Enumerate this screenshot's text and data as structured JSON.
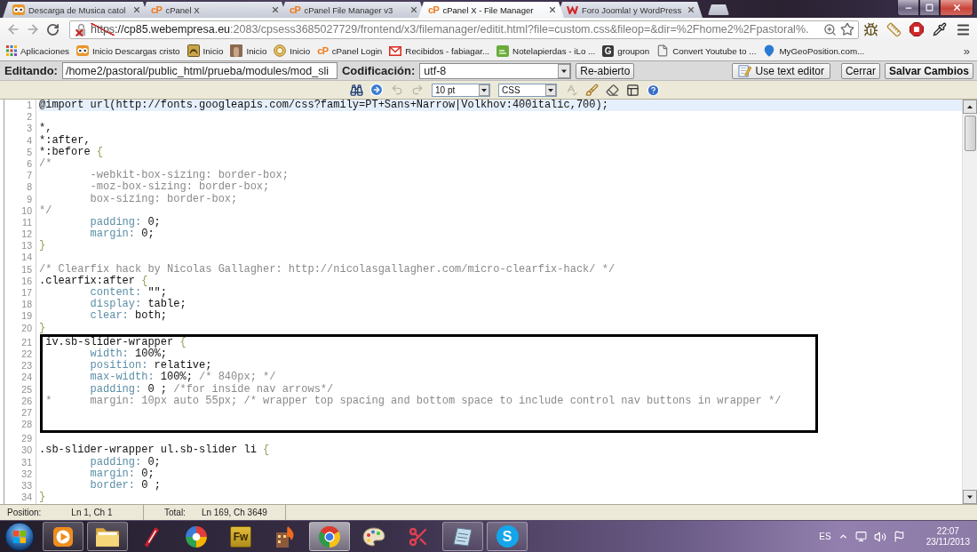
{
  "browser": {
    "tabs": [
      {
        "title": "Descarga de Musica catol",
        "kind": "owl",
        "selected": false
      },
      {
        "title": "cPanel X",
        "kind": "cpanel",
        "icon_text": "cP",
        "selected": false
      },
      {
        "title": "cPanel File Manager v3",
        "kind": "cpanel",
        "icon_text": "cP",
        "selected": false
      },
      {
        "title": "cPanel X - File Manager",
        "kind": "cpanel",
        "icon_text": "cP",
        "selected": true
      },
      {
        "title": "Foro Joomla! y WordPress",
        "kind": "wave",
        "selected": false
      }
    ],
    "address_bar": {
      "secure": false,
      "scheme": "https",
      "host": "://cp85.webempresa.eu",
      "path": ":2083/cpsess3685027729/frontend/x3/filemanager/editit.html?file=custom.css&fileop=&dir=%2Fhome2%2Fpastoral%."
    },
    "bookmarks": [
      {
        "label": "Aplicaciones",
        "kind": "apps"
      },
      {
        "label": "Inicio Descargas cristo",
        "kind": "owl"
      },
      {
        "label": "Inicio",
        "kind": "emblem"
      },
      {
        "label": "Inicio",
        "kind": "photo"
      },
      {
        "label": "Inicio",
        "kind": "medallion"
      },
      {
        "label": "cPanel Login",
        "kind": "cpanel",
        "icon_text": "cP"
      },
      {
        "label": "Recibidos - fabiagar...",
        "kind": "mail"
      },
      {
        "label": "Notelapierdas - iLo ...",
        "kind": "green-tile"
      },
      {
        "label": "groupon",
        "kind": "dark-tile",
        "icon_text": "G"
      },
      {
        "label": "Convert Youtube to ...",
        "kind": "page"
      },
      {
        "label": "MyGeoPosition.com...",
        "kind": "pin"
      }
    ],
    "more_bookmarks": "»"
  },
  "file_editor": {
    "editing_label": "Editando:",
    "path": "/home2/pastoral/public_html/prueba/modules/mod_sli",
    "encoding_label": "Codificación:",
    "encoding": "utf-8",
    "reopen_button": "Re-abierto",
    "text_editor_button": "Use text editor",
    "close_button": "Cerrar",
    "save_button": "Salvar Cambios",
    "tools": [
      {
        "kind": "search",
        "disabled": false
      },
      {
        "kind": "go-to-line",
        "disabled": false
      },
      {
        "kind": "undo",
        "disabled": true
      },
      {
        "kind": "redo",
        "disabled": true
      },
      {
        "kind": "font-size-select",
        "value": "10 pt",
        "disabled": false
      },
      {
        "kind": "syntax-select",
        "value": "CSS",
        "disabled": false
      },
      {
        "kind": "spellcheck",
        "disabled": true
      },
      {
        "kind": "highlight",
        "disabled": false
      },
      {
        "kind": "reset-highlight",
        "disabled": false
      },
      {
        "kind": "toggle-editor",
        "disabled": false
      },
      {
        "kind": "help",
        "disabled": false
      }
    ],
    "lines": [
      {
        "number": "1",
        "current": true,
        "framed": false,
        "tokens": [
          {
            "kind": "plain",
            "text": "@import url(http://fonts.googleapis.com/css?family=PT+Sans+Narrow|Volkhov:400italic,700);"
          }
        ]
      },
      {
        "number": "2",
        "current": false,
        "framed": false
      },
      {
        "number": "3",
        "current": false,
        "framed": false,
        "tokens": [
          {
            "kind": "plain",
            "text": "*,"
          }
        ]
      },
      {
        "number": "4",
        "current": false,
        "framed": false,
        "tokens": [
          {
            "kind": "plain",
            "text": "*:after,"
          }
        ]
      },
      {
        "number": "5",
        "current": false,
        "framed": false,
        "tokens": [
          {
            "kind": "plain",
            "text": "*:before "
          },
          {
            "kind": "brace",
            "text": "{"
          }
        ]
      },
      {
        "number": "6",
        "current": false,
        "framed": false,
        "tokens": [
          {
            "kind": "comment",
            "text": "/*"
          }
        ]
      },
      {
        "number": "7",
        "current": false,
        "framed": false,
        "tokens": [
          {
            "kind": "comment",
            "text": "\t-webkit-box-sizing: border-box;"
          }
        ]
      },
      {
        "number": "8",
        "current": false,
        "framed": false,
        "tokens": [
          {
            "kind": "comment",
            "text": "\t-moz-box-sizing: border-box;"
          }
        ]
      },
      {
        "number": "9",
        "current": false,
        "framed": false,
        "tokens": [
          {
            "kind": "comment",
            "text": "\tbox-sizing: border-box;"
          }
        ]
      },
      {
        "number": "10",
        "current": false,
        "framed": false,
        "tokens": [
          {
            "kind": "comment",
            "text": "*/"
          }
        ]
      },
      {
        "number": "11",
        "current": false,
        "framed": false,
        "tokens": [
          {
            "kind": "property",
            "text": "\tpadding:"
          },
          {
            "kind": "plain",
            "text": " 0;"
          }
        ]
      },
      {
        "number": "12",
        "current": false,
        "framed": false,
        "tokens": [
          {
            "kind": "property",
            "text": "\tmargin:"
          },
          {
            "kind": "plain",
            "text": " 0;"
          }
        ]
      },
      {
        "number": "13",
        "current": false,
        "framed": false,
        "tokens": [
          {
            "kind": "brace",
            "text": "}"
          }
        ]
      },
      {
        "number": "14",
        "current": false,
        "framed": false
      },
      {
        "number": "15",
        "current": false,
        "framed": false,
        "tokens": [
          {
            "kind": "comment",
            "text": "/* Clearfix hack by Nicolas Gallagher: http://nicolasgallagher.com/micro-clearfix-hack/ */"
          }
        ]
      },
      {
        "number": "16",
        "current": false,
        "framed": false,
        "tokens": [
          {
            "kind": "plain",
            "text": ".clearfix:after "
          },
          {
            "kind": "brace",
            "text": "{"
          }
        ]
      },
      {
        "number": "17",
        "current": false,
        "framed": false,
        "tokens": [
          {
            "kind": "property",
            "text": "\tcontent:"
          },
          {
            "kind": "plain",
            "text": " \"\";"
          }
        ]
      },
      {
        "number": "18",
        "current": false,
        "framed": false,
        "tokens": [
          {
            "kind": "property",
            "text": "\tdisplay:"
          },
          {
            "kind": "plain",
            "text": " table;"
          }
        ]
      },
      {
        "number": "19",
        "current": false,
        "framed": false,
        "tokens": [
          {
            "kind": "property",
            "text": "\tclear:"
          },
          {
            "kind": "plain",
            "text": " both;"
          }
        ]
      },
      {
        "number": "20",
        "current": false,
        "framed": false,
        "tokens": [
          {
            "kind": "brace",
            "text": "}"
          }
        ]
      },
      {
        "number": "21",
        "current": false,
        "framed": true,
        "tokens": [
          {
            "kind": "plain",
            "text": "iv.sb-slider-wrapper "
          },
          {
            "kind": "brace",
            "text": "{"
          }
        ]
      },
      {
        "number": "22",
        "current": false,
        "framed": true,
        "tokens": [
          {
            "kind": "property",
            "text": "\twidth:"
          },
          {
            "kind": "plain",
            "text": " 100%;"
          }
        ]
      },
      {
        "number": "23",
        "current": false,
        "framed": true,
        "tokens": [
          {
            "kind": "property",
            "text": "\tposition:"
          },
          {
            "kind": "plain",
            "text": " relative;"
          }
        ]
      },
      {
        "number": "24",
        "current": false,
        "framed": true,
        "tokens": [
          {
            "kind": "property",
            "text": "\tmax-width:"
          },
          {
            "kind": "plain",
            "text": " 100%; "
          },
          {
            "kind": "comment",
            "text": "/* 840px; */"
          }
        ]
      },
      {
        "number": "25",
        "current": false,
        "framed": true,
        "tokens": [
          {
            "kind": "property",
            "text": "\tpadding:"
          },
          {
            "kind": "plain",
            "text": " 0 ; "
          },
          {
            "kind": "comment",
            "text": "/*for inside nav arrows*/"
          }
        ]
      },
      {
        "number": "26",
        "current": false,
        "framed": true,
        "tokens": [
          {
            "kind": "comment",
            "text": "*\tmargin: 10px auto 55px; /* wrapper top spacing and bottom space to include control nav buttons in wrapper */"
          }
        ]
      },
      {
        "number": "27",
        "current": false,
        "framed": true
      },
      {
        "number": "28",
        "current": false,
        "framed": true
      },
      {
        "number": "29",
        "current": false,
        "framed": false
      },
      {
        "number": "30",
        "current": false,
        "framed": false,
        "tokens": [
          {
            "kind": "plain",
            "text": ".sb-slider-wrapper ul.sb-slider li "
          },
          {
            "kind": "brace",
            "text": "{"
          }
        ]
      },
      {
        "number": "31",
        "current": false,
        "framed": false,
        "tokens": [
          {
            "kind": "property",
            "text": "\tpadding:"
          },
          {
            "kind": "plain",
            "text": " 0;"
          }
        ]
      },
      {
        "number": "32",
        "current": false,
        "framed": false,
        "tokens": [
          {
            "kind": "property",
            "text": "\tmargin:"
          },
          {
            "kind": "plain",
            "text": " 0;"
          }
        ]
      },
      {
        "number": "33",
        "current": false,
        "framed": false,
        "tokens": [
          {
            "kind": "property",
            "text": "\tborder:"
          },
          {
            "kind": "plain",
            "text": " 0 ;"
          }
        ]
      },
      {
        "number": "34",
        "current": false,
        "framed": false,
        "tokens": [
          {
            "kind": "brace",
            "text": "}"
          }
        ]
      }
    ],
    "status_bar": {
      "position_label": "Position:",
      "position_value": "Ln 1, Ch 1",
      "total_label": "Total:",
      "total_value": "Ln 169, Ch 3649"
    }
  },
  "taskbar": {
    "items": [
      {
        "kind": "media-player",
        "running": true,
        "selected": false
      },
      {
        "kind": "folder",
        "running": true,
        "selected": false
      },
      {
        "kind": "marker",
        "running": false,
        "selected": false
      },
      {
        "kind": "pinwheel",
        "running": false,
        "selected": false
      },
      {
        "kind": "tile",
        "icon_text": "Fw",
        "running": false,
        "selected": false
      },
      {
        "kind": "building",
        "running": false,
        "selected": false
      },
      {
        "kind": "browser",
        "running": true,
        "selected": true
      },
      {
        "kind": "palette",
        "running": false,
        "selected": false
      },
      {
        "kind": "scissors",
        "running": false,
        "selected": false
      },
      {
        "kind": "notes",
        "running": true,
        "selected": false
      },
      {
        "kind": "disc",
        "icon_text": "S",
        "running": true,
        "selected": false
      }
    ],
    "language": "ES",
    "time": "22:07",
    "date": "23/11/2013"
  }
}
